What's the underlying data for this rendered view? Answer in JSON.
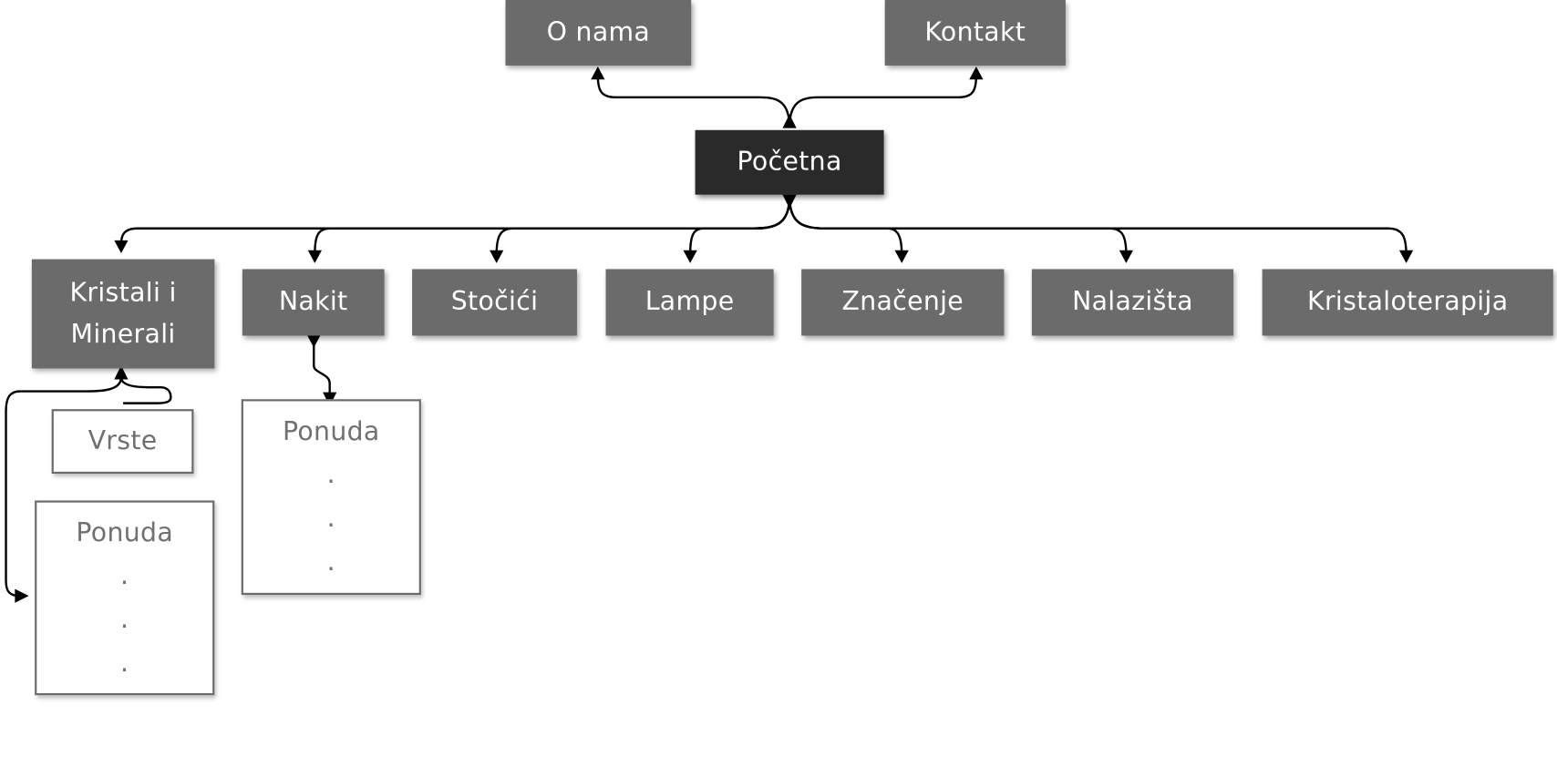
{
  "nodes": {
    "o_nama": "O nama",
    "kontakt": "Kontakt",
    "pocetna": "Početna",
    "kristali_line1": "Kristali i",
    "kristali_line2": "Minerali",
    "nakit": "Nakit",
    "stocici": "Stočići",
    "lampe": "Lampe",
    "znacenje": "Značenje",
    "nalazista": "Nalazišta",
    "kristaloterapija": "Kristaloterapija",
    "vrste": "Vrste",
    "ponuda_kristali": "Ponuda",
    "ponuda_nakit": "Ponuda"
  },
  "list_marker": ".",
  "colors": {
    "box_dark": "#6b6b6b",
    "box_root": "#2a2a2a",
    "box_light_border": "#6b6b6b",
    "text_light": "#707070",
    "connector": "#000000"
  }
}
